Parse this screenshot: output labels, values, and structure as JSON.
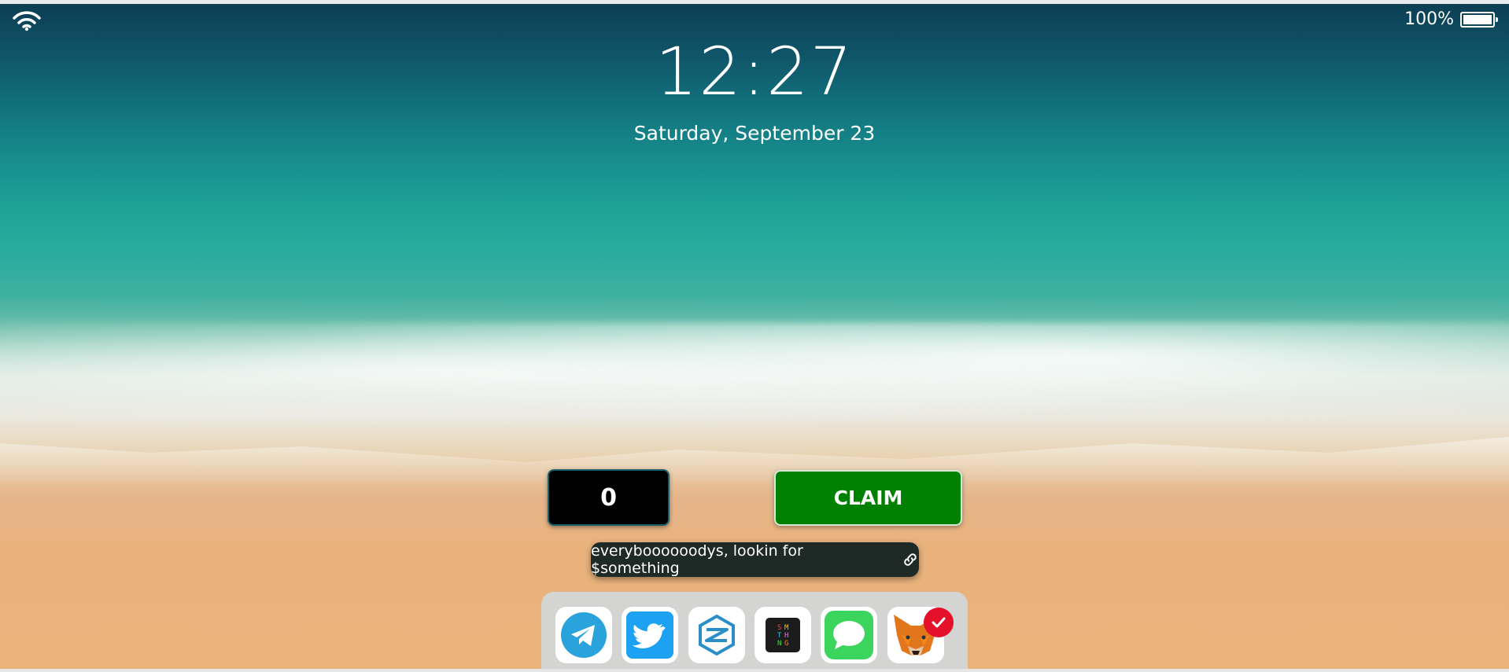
{
  "status_bar": {
    "battery_percent": "100%",
    "battery_level": 1.0,
    "wifi_icon": "wifi-icon",
    "battery_icon": "battery-icon"
  },
  "lockscreen": {
    "time": "12:27",
    "date": "Saturday, September 23"
  },
  "widget": {
    "counter_value": "0",
    "claim_label": "CLAIM",
    "claim_color": "#008000",
    "tagline": "everyboooooodys, lookin for $something",
    "tagline_icon": "link-icon"
  },
  "dock": {
    "apps": [
      {
        "name": "telegram",
        "icon": "telegram-icon",
        "color": "#2aa3dd"
      },
      {
        "name": "twitter",
        "icon": "twitter-icon",
        "color": "#1da1f2"
      },
      {
        "name": "hexagon-app",
        "icon": "hexagon-logo-icon",
        "color": "#2a8fc9"
      },
      {
        "name": "smthng",
        "icon": "smthng-icon",
        "color": "#1c1c1c"
      },
      {
        "name": "messages",
        "icon": "messages-icon",
        "color": "#3bd45c"
      },
      {
        "name": "metamask",
        "icon": "metamask-fox-icon",
        "color": "#e2761b",
        "badge": "check-badge-icon",
        "badge_color": "#e5102a"
      }
    ]
  }
}
